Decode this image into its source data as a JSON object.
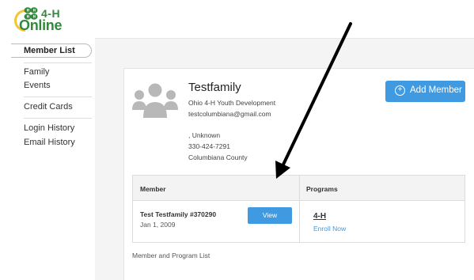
{
  "brand": {
    "logo_top": "4-H",
    "logo_bottom": "Online"
  },
  "sidebar": {
    "items": [
      {
        "label": "Member List"
      },
      {
        "label": "Family"
      },
      {
        "label": "Events"
      },
      {
        "label": "Credit Cards"
      },
      {
        "label": "Login History"
      },
      {
        "label": "Email History"
      }
    ]
  },
  "family": {
    "name": "Testfamily",
    "organization": "Ohio 4-H Youth Development",
    "email": "testcolumbiana@gmail.com",
    "city_state": ", Unknown",
    "phone": "330-424-7291",
    "county": "Columbiana County",
    "avatar_icon": "family-group-icon"
  },
  "actions": {
    "add_member_label": "Add Member",
    "add_member_icon": "plus-circle-icon"
  },
  "members_table": {
    "headers": [
      "Member",
      "Programs"
    ],
    "rows": [
      {
        "member_name": "Test Testfamily #370290",
        "birthdate": "Jan 1, 2009",
        "view_label": "View",
        "program": "4-H",
        "enroll_label": "Enroll Now"
      }
    ]
  },
  "list_caption": "Member and Program List",
  "colors": {
    "accent_blue": "#3f9ae2",
    "brand_green": "#2e8b3a",
    "brand_gold": "#f4c531",
    "annotation_arrow": "#000000"
  }
}
